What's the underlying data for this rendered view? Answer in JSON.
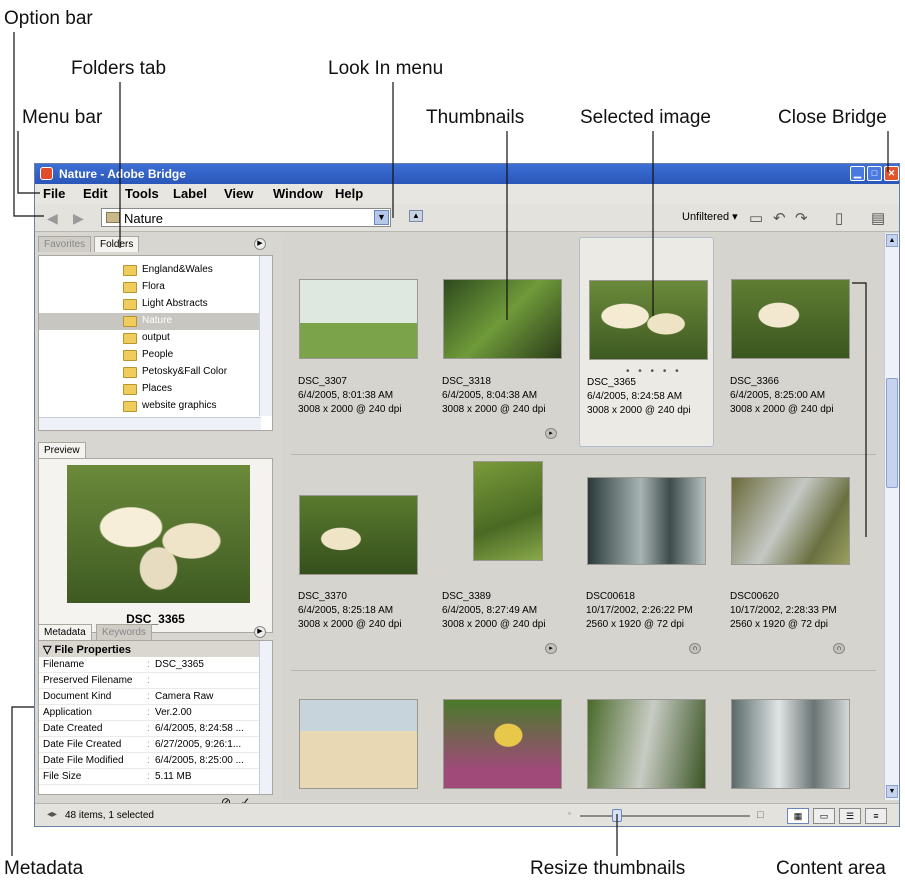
{
  "callouts": {
    "option_bar": "Option bar",
    "folders_tab": "Folders tab",
    "look_in_menu": "Look In menu",
    "menu_bar": "Menu bar",
    "thumbnails": "Thumbnails",
    "selected_image": "Selected image",
    "close_bridge": "Close Bridge",
    "metadata": "Metadata",
    "resize_thumbnails": "Resize thumbnails",
    "content_area": "Content area"
  },
  "window": {
    "title": "Nature - Adobe Bridge"
  },
  "menu": {
    "file": "File",
    "edit": "Edit",
    "tools": "Tools",
    "label": "Label",
    "view": "View",
    "window": "Window",
    "help": "Help"
  },
  "optionbar": {
    "look_in_value": "Nature",
    "filter_label": "Unfiltered ▾"
  },
  "tabs": {
    "favorites": "Favorites",
    "folders": "Folders",
    "preview": "Preview",
    "metadata": "Metadata",
    "keywords": "Keywords"
  },
  "folders": [
    {
      "label": "England&Wales"
    },
    {
      "label": "Flora"
    },
    {
      "label": "Light Abstracts"
    },
    {
      "label": "Nature"
    },
    {
      "label": "output"
    },
    {
      "label": "People"
    },
    {
      "label": "Petosky&Fall Color"
    },
    {
      "label": "Places"
    },
    {
      "label": "website graphics"
    }
  ],
  "preview": {
    "name": "DSC_3365"
  },
  "metadata_panel": {
    "section": "▽ File Properties",
    "rows": [
      {
        "key": "Filename",
        "value": "DSC_3365"
      },
      {
        "key": "Preserved Filename",
        "value": ""
      },
      {
        "key": "Document Kind",
        "value": "Camera Raw"
      },
      {
        "key": "Application",
        "value": "Ver.2.00"
      },
      {
        "key": "Date Created",
        "value": "6/4/2005, 8:24:58 ..."
      },
      {
        "key": "Date File Created",
        "value": "6/27/2005, 9:26:1..."
      },
      {
        "key": "Date File Modified",
        "value": "6/4/2005, 8:25:00 ..."
      },
      {
        "key": "File Size",
        "value": "5.11 MB"
      }
    ]
  },
  "thumbnails": [
    {
      "name": "DSC_3307",
      "date": "6/4/2005, 8:01:38 AM",
      "dims": "3008 x 2000 @ 240 dpi"
    },
    {
      "name": "DSC_3318",
      "date": "6/4/2005, 8:04:38 AM",
      "dims": "3008 x 2000 @ 240 dpi"
    },
    {
      "name": "DSC_3365",
      "date": "6/4/2005, 8:24:58 AM",
      "dims": "3008 x 2000 @ 240 dpi"
    },
    {
      "name": "DSC_3366",
      "date": "6/4/2005, 8:25:00 AM",
      "dims": "3008 x 2000 @ 240 dpi"
    },
    {
      "name": "DSC_3370",
      "date": "6/4/2005, 8:25:18 AM",
      "dims": "3008 x 2000 @ 240 dpi"
    },
    {
      "name": "DSC_3389",
      "date": "6/4/2005, 8:27:49 AM",
      "dims": "3008 x 2000 @ 240 dpi"
    },
    {
      "name": "DSC00618",
      "date": "10/17/2002, 2:26:22 PM",
      "dims": "2560 x 1920 @ 72 dpi"
    },
    {
      "name": "DSC00620",
      "date": "10/17/2002, 2:28:33 PM",
      "dims": "2560 x 1920 @ 72 dpi"
    }
  ],
  "rating_dots": "• • • • •",
  "status": {
    "text": "48 items, 1 selected"
  },
  "colors": {
    "title_bar": "#2a56b8",
    "selection": "#b4bdd0",
    "content_bg": "#d6d4ce"
  }
}
